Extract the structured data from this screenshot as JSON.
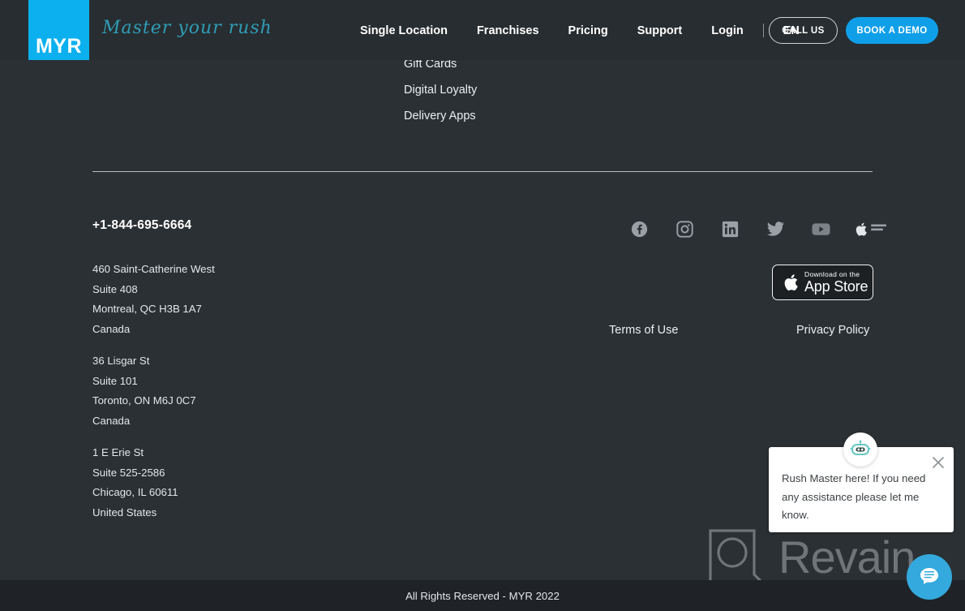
{
  "theme": {
    "bg": "#2b3034",
    "header_bg": "#282d31",
    "accent": "#0cb0ef",
    "cta_blue": "#0f9fe8",
    "tagline_teal": "#2e9db5",
    "bottom_bar_bg": "#1f2327",
    "chat_fab_blue": "#34a9dd",
    "text": "#eceff1",
    "divider": "#b9bdc0"
  },
  "header": {
    "logo_text": "MYR",
    "tagline": "Master your rush",
    "nav": [
      {
        "label": "Single Location",
        "name": "nav-single-location"
      },
      {
        "label": "Franchises",
        "name": "nav-franchises"
      },
      {
        "label": "Pricing",
        "name": "nav-pricing"
      },
      {
        "label": "Support",
        "name": "nav-support"
      },
      {
        "label": "Login",
        "name": "nav-login"
      }
    ],
    "language": "EN",
    "call_us": "CALL US",
    "book_demo": "BOOK A DEMO"
  },
  "footer": {
    "links": [
      {
        "label": "Gift Cards",
        "name": "footer-link-gift-cards"
      },
      {
        "label": "Digital Loyalty",
        "name": "footer-link-digital-loyalty"
      },
      {
        "label": "Delivery Apps",
        "name": "footer-link-delivery-apps"
      }
    ],
    "phone": "+1-844-695-6664",
    "addresses": [
      {
        "line1": "460 Saint-Catherine West",
        "line2": "Suite 408",
        "line3": "Montreal, QC H3B 1A7",
        "line4": "Canada"
      },
      {
        "line1": "36 Lisgar St",
        "line2": "Suite 101",
        "line3": "Toronto, ON M6J 0C7",
        "line4": "Canada"
      },
      {
        "line1": "1 E Erie St",
        "line2": "Suite 525-2586",
        "line3": "Chicago, IL 60611",
        "line4": "United States"
      }
    ],
    "socials": [
      {
        "icon": "facebook-icon"
      },
      {
        "icon": "instagram-icon"
      },
      {
        "icon": "linkedin-icon"
      },
      {
        "icon": "twitter-icon"
      },
      {
        "icon": "youtube-icon"
      },
      {
        "icon": "apple-authorized-reseller-icon"
      }
    ],
    "appstore": {
      "small": "Download on the",
      "big": "App Store"
    },
    "legal": {
      "terms": "Terms of Use",
      "privacy": "Privacy Policy"
    },
    "copyright": "All Rights Reserved - MYR 2022"
  },
  "watermark": {
    "word": "Revain"
  },
  "chat": {
    "message": "Rush Master here! If you need any assistance please let me know."
  }
}
